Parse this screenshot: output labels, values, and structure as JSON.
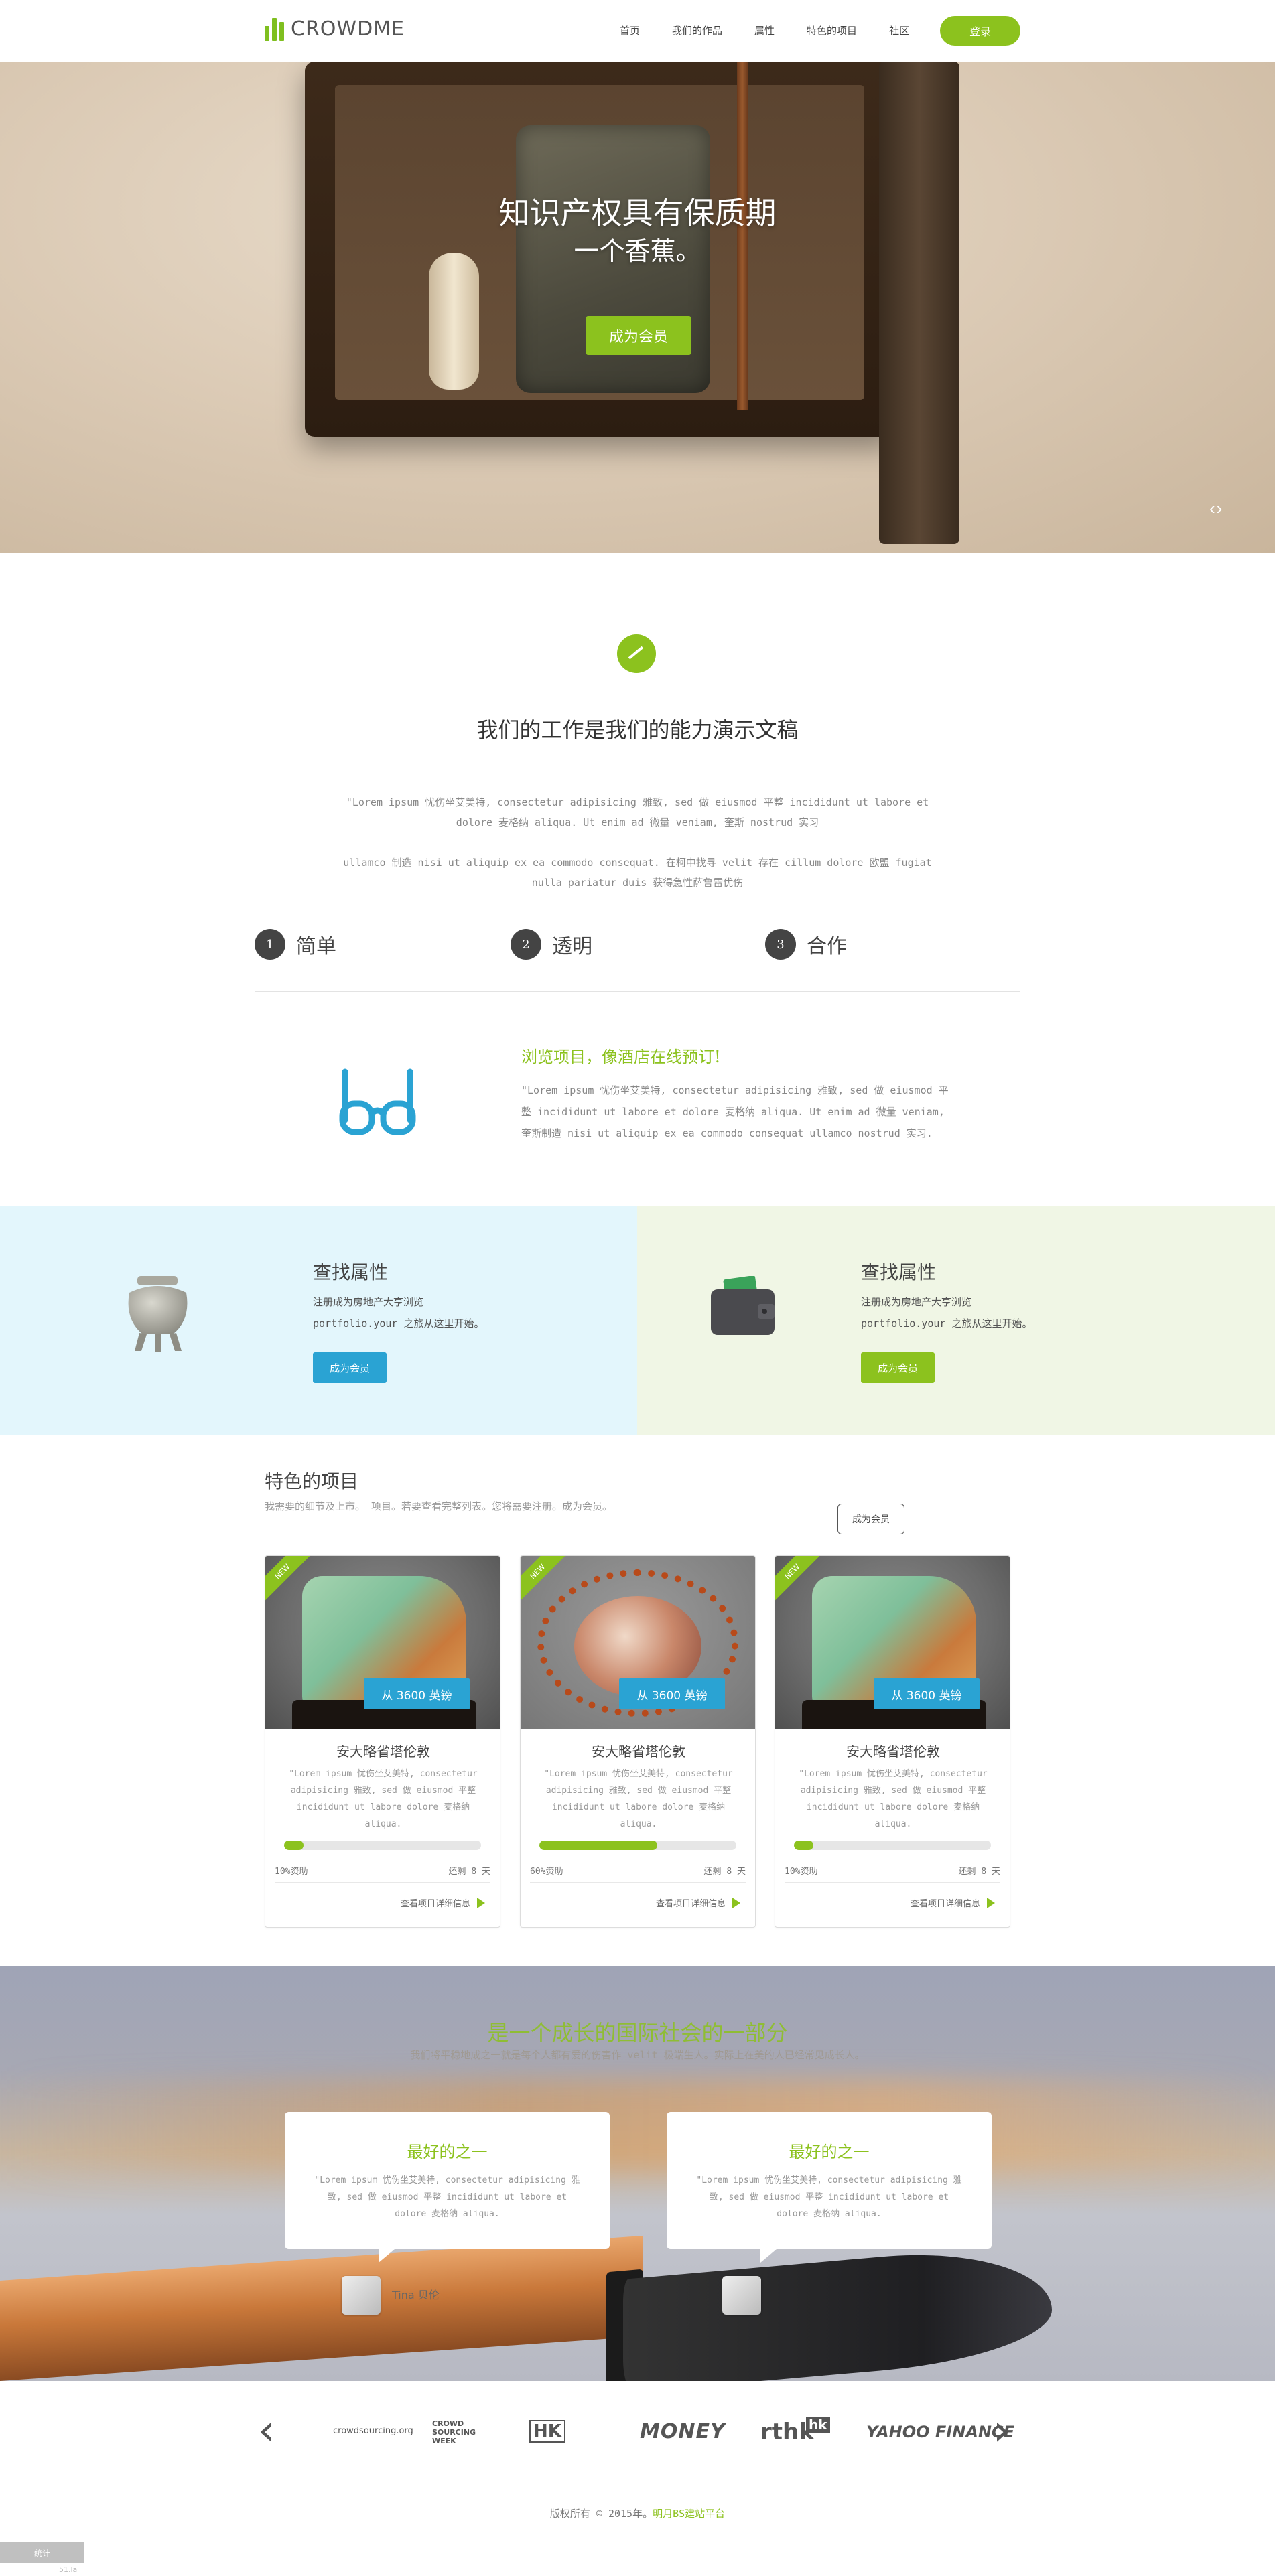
{
  "header": {
    "logo_text": "CROWDME",
    "nav": [
      "首页",
      "我们的作品",
      "属性",
      "特色的项目",
      "社区"
    ],
    "login_label": "登录"
  },
  "hero": {
    "title": "知识产权具有保质期",
    "subtitle": "一个香蕉。",
    "button_label": "成为会员",
    "arrows": "‹›"
  },
  "intro": {
    "title": "我们的工作是我们的能力演示文稿",
    "paragraph1": "\"Lorem ipsum 忧伤坐艾美特, consectetur adipisicing 雅致, sed 做 eiusmod 平整 incididunt ut labore et dolore 麦格纳 aliqua. Ut enim ad 微量 veniam, 奎斯 nostrud 实习",
    "paragraph2": "ullamco 制造 nisi ut aliquip ex ea commodo consequat. 在柯中找寻 velit 存在 cillum dolore 欧盟 fugiat nulla pariatur duis 获得急性萨鲁雷优伤",
    "steps": [
      {
        "num": "1",
        "label": "简单"
      },
      {
        "num": "2",
        "label": "透明"
      },
      {
        "num": "3",
        "label": "合作"
      }
    ],
    "feature_title": "浏览项目，像酒店在线预订!",
    "feature_text": "\"Lorem ipsum 忧伤坐艾美特, consectetur adipisicing 雅致, sed 做 eiusmod 平整 incididunt ut labore et dolore 麦格纳 aliqua. Ut enim ad 微量 veniam, 奎斯制造 nisi ut aliquip ex ea commodo consequat ullamco nostrud 实习."
  },
  "panels": [
    {
      "title": "查找属性",
      "line1": "注册成为房地产大亨浏览",
      "line2": "portfolio.your 之旅从这里开始。",
      "button_label": "成为会员",
      "color": "#2aa3d3"
    },
    {
      "title": "查找属性",
      "line1": "注册成为房地产大亨浏览",
      "line2": "portfolio.your 之旅从这里开始。",
      "button_label": "成为会员",
      "color": "#8cc21e"
    }
  ],
  "featured": {
    "title": "特色的项目",
    "subtitle": "我需要的细节及上市。 项目。若要查看完整列表。您将需要注册。成为会员。",
    "button_label": "成为会员",
    "cards": [
      {
        "badge": "NEW",
        "price": "从 3600 英镑",
        "title": "安大略省塔伦敦",
        "desc": "\"Lorem ipsum 忧伤坐艾美特, consectetur adipisicing 雅致, sed 做 eiusmod 平整 incididunt ut labore dolore 麦格纳 aliqua.",
        "progress": 0.1,
        "funded": "10%资助",
        "remaining": "还剩 8 天",
        "link": "查看项目详细信息"
      },
      {
        "badge": "NEW",
        "price": "从 3600 英镑",
        "title": "安大略省塔伦敦",
        "desc": "\"Lorem ipsum 忧伤坐艾美特, consectetur adipisicing 雅致, sed 做 eiusmod 平整 incididunt ut labore dolore 麦格纳 aliqua.",
        "progress": 0.6,
        "funded": "60%资助",
        "remaining": "还剩 8 天",
        "link": "查看项目详细信息"
      },
      {
        "badge": "NEW",
        "price": "从 3600 英镑",
        "title": "安大略省塔伦敦",
        "desc": "\"Lorem ipsum 忧伤坐艾美特, consectetur adipisicing 雅致, sed 做 eiusmod 平整 incididunt ut labore dolore 麦格纳 aliqua.",
        "progress": 0.1,
        "funded": "10%资助",
        "remaining": "还剩 8 天",
        "link": "查看项目详细信息"
      }
    ]
  },
  "testimonials": {
    "title": "是一个成长的国际社会的一部分",
    "subtitle": "我们将平稳地成之一就是每个人都有爱的伤害作 velit 极端生人。实际上在美的人已经常见成长人。",
    "items": [
      {
        "title": "最好的之一",
        "text": "\"Lorem ipsum 忧伤坐艾美特, consectetur adipisicing 雅致, sed 做 eiusmod 平整 incididunt ut labore et dolore 麦格纳 aliqua.",
        "name": "Tina 贝伦"
      },
      {
        "title": "最好的之一",
        "text": "\"Lorem ipsum 忧伤坐艾美特, consectetur adipisicing 雅致, sed 做 eiusmod 平整 incididunt ut labore et dolore 麦格纳 aliqua.",
        "name": ""
      }
    ]
  },
  "partners": {
    "prev": "‹",
    "next": "›",
    "logos": [
      "crowdsourcing.org",
      "CROWD SOURCING WEEK",
      "HK",
      "MONEY",
      "rthk",
      "hk",
      "YAHOO FINANCE"
    ]
  },
  "footer": {
    "copyright": "版权所有 © 2015年。",
    "link": "明月BS建站平台",
    "badge": "统计",
    "badge_sub": "51.la"
  },
  "colors": {
    "accent_green": "#8cc21e",
    "accent_blue": "#2aa3d3"
  }
}
